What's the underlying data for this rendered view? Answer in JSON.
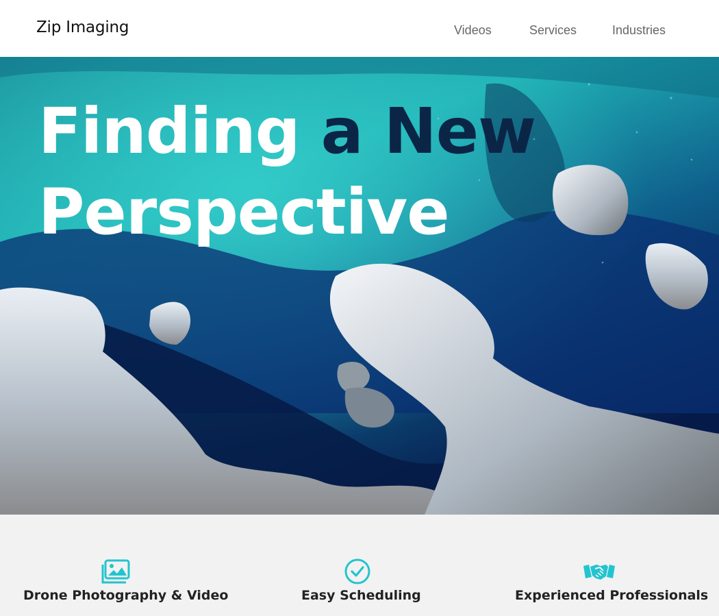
{
  "header": {
    "brand": "Zip Imaging",
    "nav": [
      {
        "label": "Videos"
      },
      {
        "label": "Services"
      },
      {
        "label": "Industries"
      }
    ]
  },
  "hero": {
    "headline_part1": "Finding",
    "headline_part2": "a New",
    "headline_part3": "Perspective"
  },
  "features": [
    {
      "icon": "image-gallery-icon",
      "label": "Drone Photography & Video"
    },
    {
      "icon": "check-circle-icon",
      "label": "Easy Scheduling"
    },
    {
      "icon": "handshake-icon",
      "label": "Experienced Professionals"
    }
  ],
  "colors": {
    "accent": "#22c4cf",
    "headline_dark": "#0b2547",
    "features_bg": "#f2f2f2"
  }
}
